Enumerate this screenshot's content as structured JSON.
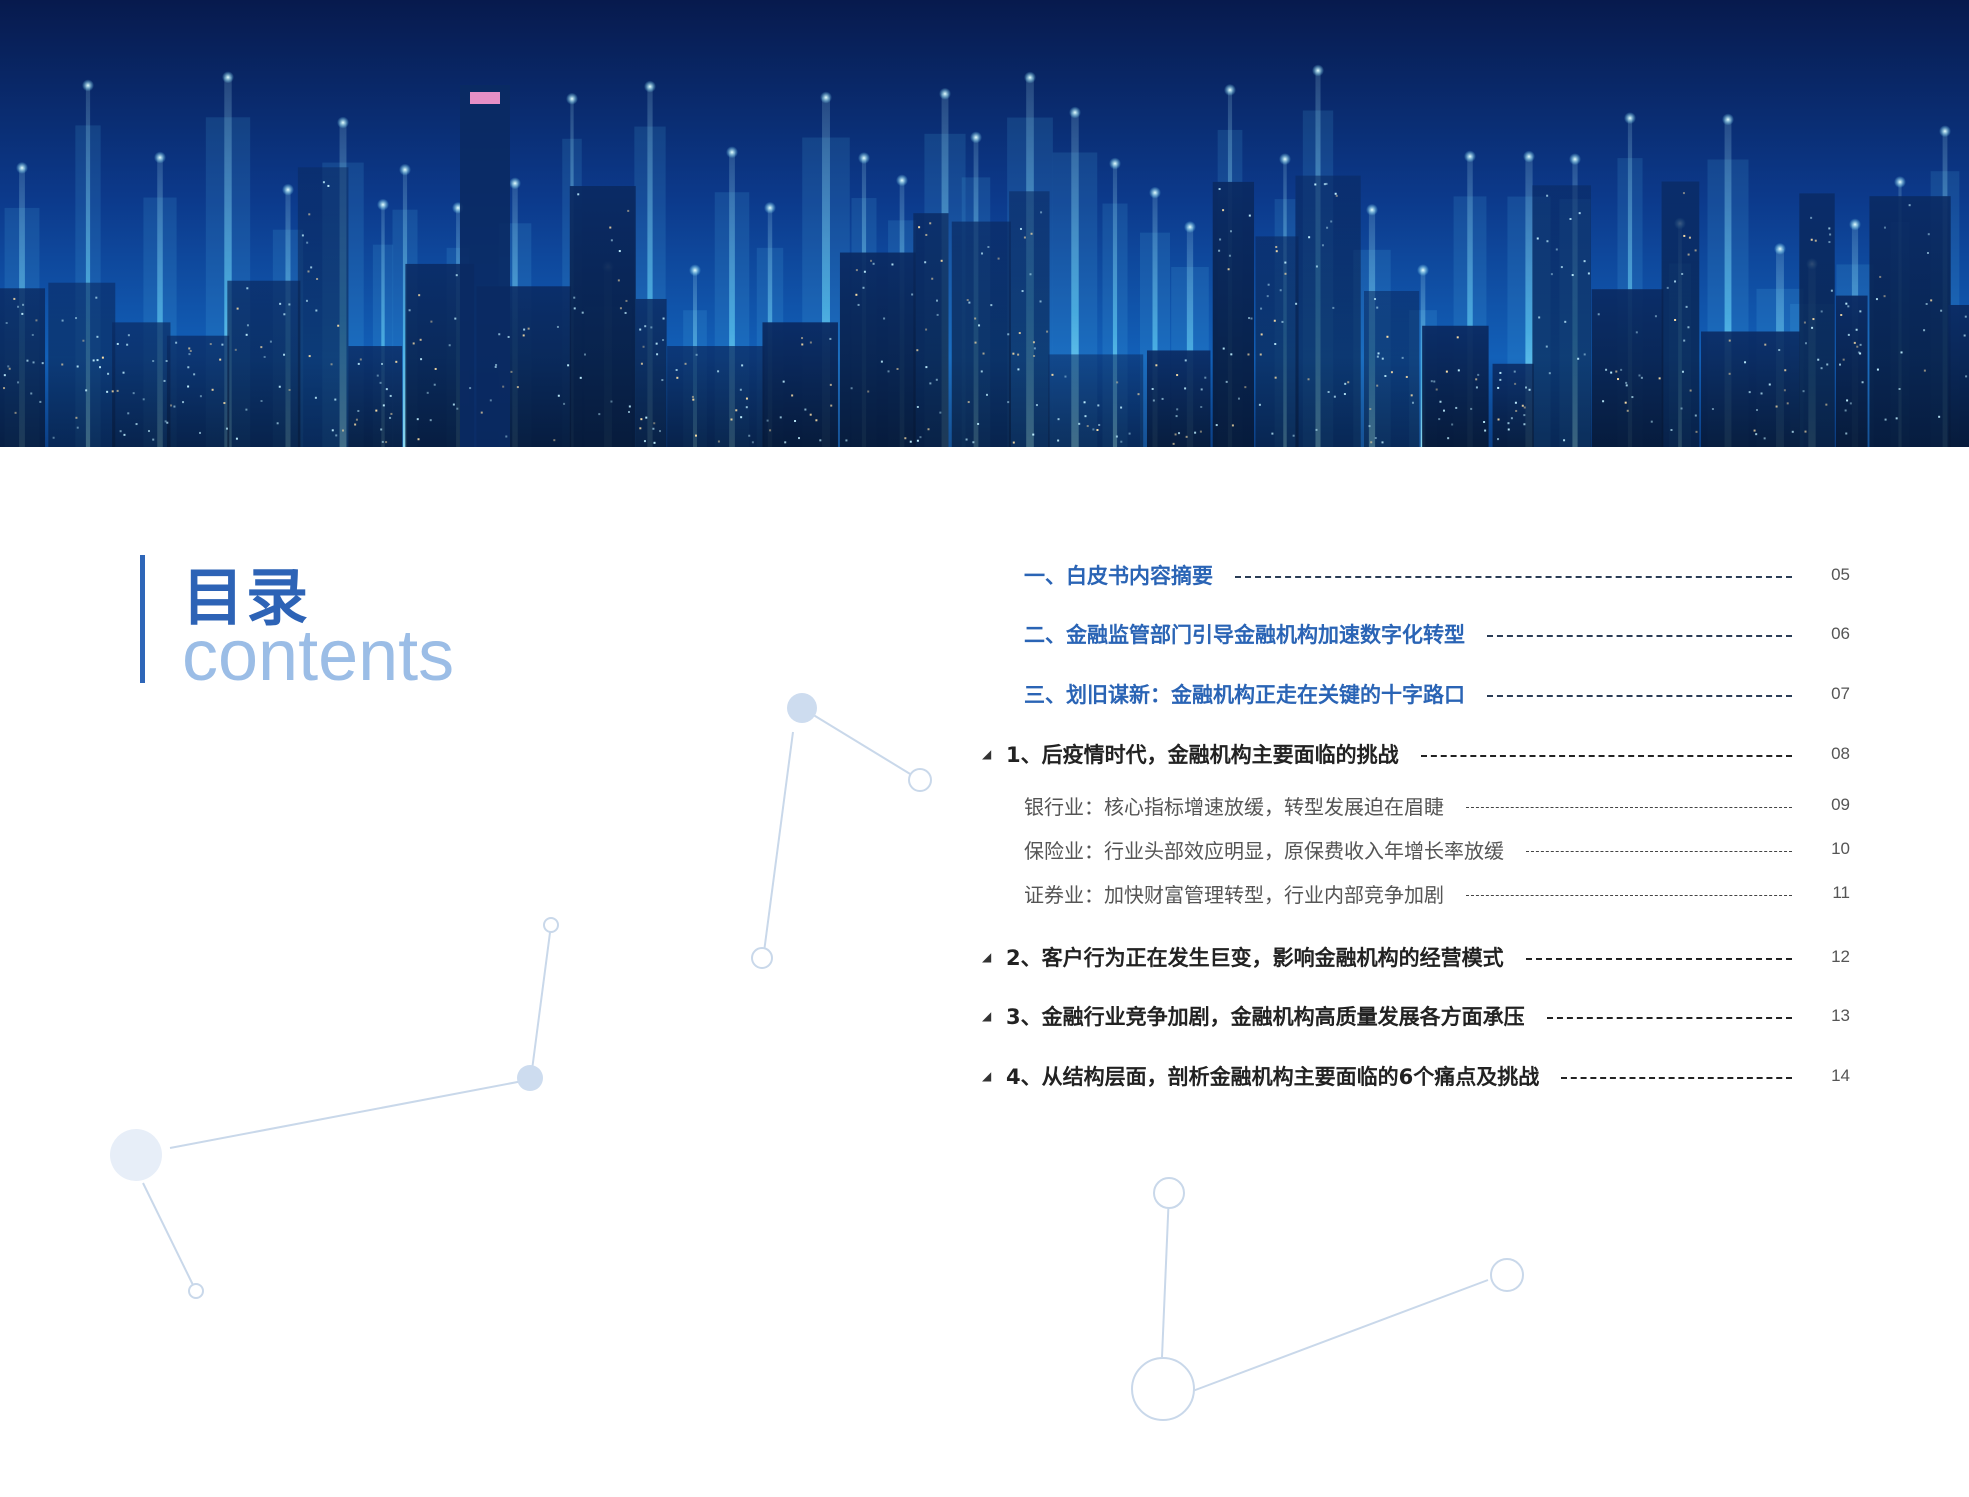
{
  "header": {
    "title_cn": "目录",
    "title_en": "contents"
  },
  "colors": {
    "accent": "#2d63b6",
    "accent_light": "#9bbde6",
    "text_dark": "#222222",
    "text_muted": "#555555"
  },
  "toc": [
    {
      "level": "section",
      "label": "一、白皮书内容摘要",
      "page": "05"
    },
    {
      "level": "section",
      "label": "二、金融监管部门引导金融机构加速数字化转型",
      "page": "06"
    },
    {
      "level": "section",
      "label": "三、划旧谋新：金融机构正走在关键的十字路口",
      "page": "07"
    },
    {
      "level": "sub",
      "arrow": "◢",
      "label": "1、后疫情时代，金融机构主要面临的挑战",
      "page": "08"
    },
    {
      "level": "item",
      "label": "银行业：核心指标增速放缓，转型发展迫在眉睫",
      "page": "09"
    },
    {
      "level": "item",
      "label": "保险业：行业头部效应明显，原保费收入年增长率放缓",
      "page": "10"
    },
    {
      "level": "item",
      "label": "证券业：加快财富管理转型，行业内部竞争加剧",
      "page": "11"
    },
    {
      "level": "sub",
      "arrow": "◢",
      "label": "2、客户行为正在发生巨变，影响金融机构的经营模式",
      "page": "12"
    },
    {
      "level": "sub",
      "arrow": "◢",
      "label": "3、金融行业竞争加剧，金融机构高质量发展各方面承压",
      "page": "13"
    },
    {
      "level": "sub",
      "arrow": "◢",
      "label": "4、从结构层面，剖析金融机构主要面临的6个痛点及挑战",
      "page": "14"
    }
  ]
}
